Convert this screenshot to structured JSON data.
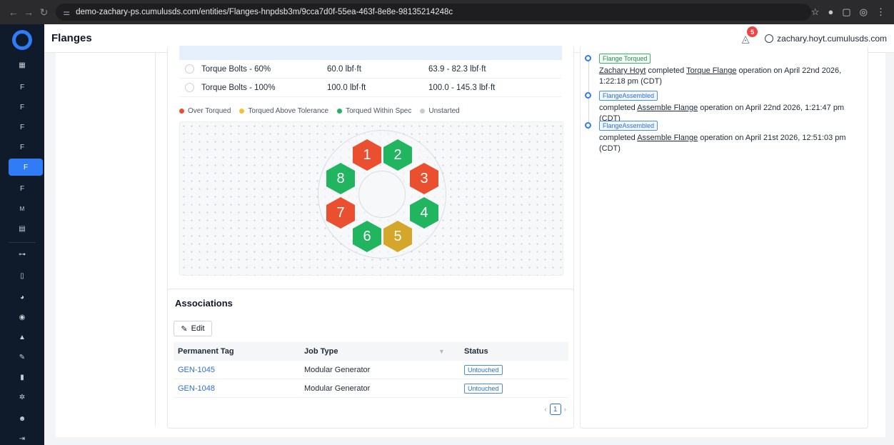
{
  "browser": {
    "url": "demo-zachary-ps.cumulusds.com/entities/Flanges-hnpdsb3m/9cca7d0f-55ea-463f-8e8e-98135214248c"
  },
  "header": {
    "title": "Flanges",
    "notification_count": "5",
    "user": "zachary.hoyt.cumulusds.com"
  },
  "sidebar": {
    "items": [
      {
        "label": "F"
      },
      {
        "label": "F"
      },
      {
        "label": "F"
      },
      {
        "label": "F"
      },
      {
        "label": "F"
      },
      {
        "label": "F"
      },
      {
        "label": "M"
      }
    ]
  },
  "torque_steps": [
    {
      "name": "Torque Bolts - 60%",
      "target": "60.0 lbf·ft",
      "range": "63.9 - 82.3 lbf·ft"
    },
    {
      "name": "Torque Bolts - 100%",
      "target": "100.0 lbf·ft",
      "range": "100.0 - 145.3 lbf·ft"
    }
  ],
  "legend": [
    {
      "label": "Over Torqued",
      "color": "#ea4f2f"
    },
    {
      "label": "Torqued Above Tolerance",
      "color": "#f2c233"
    },
    {
      "label": "Torqued Within Spec",
      "color": "#22b55f"
    },
    {
      "label": "Unstarted",
      "color": "#c9ccd1"
    }
  ],
  "bolts": [
    {
      "number": "1",
      "status": "over-torqued"
    },
    {
      "number": "2",
      "status": "within-spec"
    },
    {
      "number": "3",
      "status": "over-torqued"
    },
    {
      "number": "4",
      "status": "within-spec"
    },
    {
      "number": "5",
      "status": "above-tolerance"
    },
    {
      "number": "6",
      "status": "within-spec"
    },
    {
      "number": "7",
      "status": "over-torqued"
    },
    {
      "number": "8",
      "status": "within-spec"
    }
  ],
  "associations": {
    "title": "Associations",
    "edit_label": "Edit",
    "columns": [
      "Permanent Tag",
      "Job Type",
      "Status"
    ],
    "rows": [
      {
        "tag": "GEN-1045",
        "job_type": "Modular Generator",
        "status": "Untouched"
      },
      {
        "tag": "GEN-1048",
        "job_type": "Modular Generator",
        "status": "Untouched"
      }
    ],
    "page": "1"
  },
  "timeline": [
    {
      "tag": "Flange Torqued",
      "user": "Zachary Hoyt",
      "verb": "completed",
      "operation": "Torque Flange",
      "suffix": "operation on April 22nd 2026, 1:22:18 pm (CDT)"
    },
    {
      "tag": "FlangeAssembled",
      "user": "",
      "verb": "completed",
      "operation": "Assemble Flange",
      "suffix": "operation on April 22nd 2026, 1:21:47 pm (CDT)"
    },
    {
      "tag": "FlangeAssembled",
      "user": "",
      "verb": "completed",
      "operation": "Assemble Flange",
      "suffix": "operation on April 21st 2026, 12:51:03 pm (CDT)"
    }
  ]
}
